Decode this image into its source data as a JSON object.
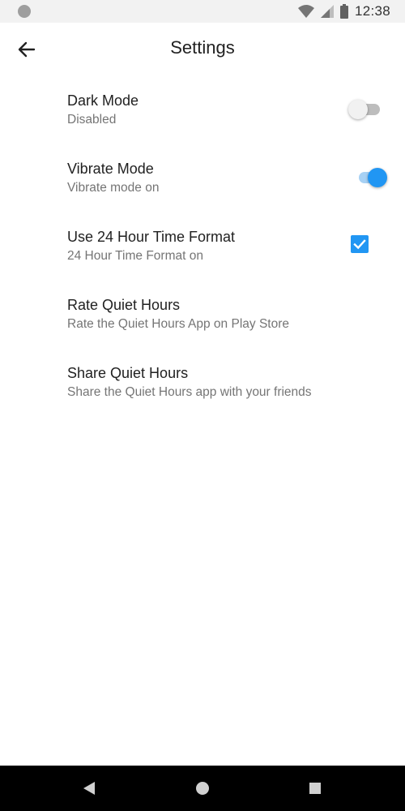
{
  "status_bar": {
    "time": "12:38"
  },
  "header": {
    "title": "Settings",
    "back_icon": "arrow-left-icon"
  },
  "settings": [
    {
      "title": "Dark Mode",
      "subtitle": "Disabled",
      "control": "switch",
      "checked": false
    },
    {
      "title": "Vibrate Mode",
      "subtitle": "Vibrate mode on",
      "control": "switch",
      "checked": true
    },
    {
      "title": "Use 24 Hour Time Format",
      "subtitle": "24 Hour Time Format on",
      "control": "checkbox",
      "checked": true
    },
    {
      "title": "Rate Quiet Hours",
      "subtitle": "Rate the Quiet Hours App on Play Store",
      "control": "none"
    },
    {
      "title": "Share Quiet Hours",
      "subtitle": "Share the Quiet Hours app with your friends",
      "control": "none"
    }
  ],
  "colors": {
    "accent": "#2196f3",
    "accent_track": "#a7d1f4",
    "primary_text": "#212121",
    "secondary_text": "#757575"
  },
  "nav_bar": {
    "back_icon": "triangle-back-icon",
    "home_icon": "circle-home-icon",
    "recents_icon": "square-recents-icon"
  }
}
